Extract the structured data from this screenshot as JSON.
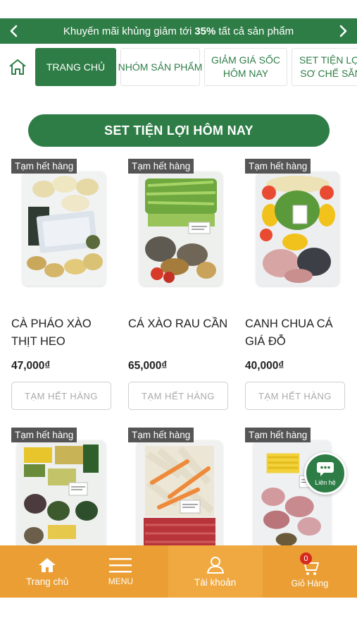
{
  "promo": {
    "text_before": "Khuyến mãi khủng giảm tới",
    "highlight": "35%",
    "text_after": "tất cả sản phẩm"
  },
  "nav": {
    "tabs": [
      {
        "label": "TRANG CHỦ",
        "active": true
      },
      {
        "label": "NHÓM SẢN PHẨM",
        "active": false
      },
      {
        "label": "GIẢM GIÁ SỐC HÔM NAY",
        "active": false
      },
      {
        "label": "SET TIỆN LỢI SƠ CHẾ SẴN",
        "active": false
      }
    ]
  },
  "section": {
    "title": "SET TIỆN LỢI HÔM NAY"
  },
  "products": [
    {
      "badge": "Tạm hết hàng",
      "name": "CÀ PHÁO XÀO THỊT HEO",
      "price": "47,000₫",
      "button": "TẠM HẾT HÀNG",
      "image": "ca-phao-tray"
    },
    {
      "badge": "Tạm hết hàng",
      "name": "CÁ XÀO RAU CẦN",
      "price": "65,000₫",
      "button": "TẠM HẾT HÀNG",
      "image": "ca-rau-can-tray"
    },
    {
      "badge": "Tạm hết hàng",
      "name": "CANH CHUA CÁ GIÁ ĐỖ",
      "price": "40,000₫",
      "button": "TẠM HẾT HÀNG",
      "image": "canh-chua-tray"
    },
    {
      "badge": "Tạm hết hàng",
      "image": "vegetable-tray"
    },
    {
      "badge": "Tạm hết hàng",
      "image": "beef-carrot-tray"
    },
    {
      "badge": "Tạm hết hàng",
      "image": "pork-tray"
    }
  ],
  "chat": {
    "label": "Liên hệ"
  },
  "bottom_nav": {
    "home": "Trang chủ",
    "menu": "MENU",
    "account": "Tài khoản",
    "cart": "Giỏ Hàng",
    "cart_count": "0"
  },
  "colors": {
    "brand_green": "#2e7d46",
    "bottom_orange": "#ea9e33",
    "badge_gray": "#555555",
    "cart_badge_red": "#d72a1e"
  }
}
